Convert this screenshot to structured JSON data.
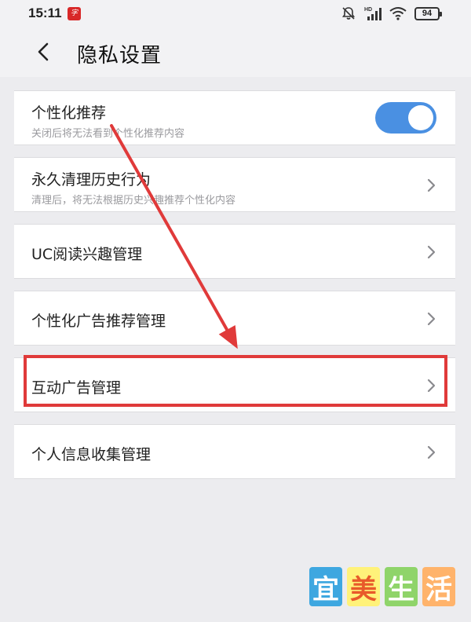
{
  "status_bar": {
    "time": "15:11",
    "app_badge": "字",
    "battery": "94",
    "icons": [
      "bell-muted-icon",
      "signal-icon",
      "wifi-icon",
      "battery-icon"
    ]
  },
  "header": {
    "back_icon": "chevron-left-icon",
    "title": "隐私设置"
  },
  "settings": {
    "personalized": {
      "title": "个性化推荐",
      "subtitle": "关闭后将无法看到个性化推荐内容",
      "toggle_on": true
    },
    "clear_history": {
      "title": "永久清理历史行为",
      "subtitle": "清理后，将无法根据历史兴趣推荐个性化内容"
    },
    "uc_interest": {
      "title": "UC阅读兴趣管理"
    },
    "ad_recommend": {
      "title": "个性化广告推荐管理"
    },
    "interactive_ad": {
      "title": "互动广告管理"
    },
    "personal_info": {
      "title": "个人信息收集管理"
    }
  },
  "watermark": {
    "chars": [
      "宜",
      "美",
      "生",
      "活"
    ]
  },
  "colors": {
    "accent": "#4a90e2",
    "annotation": "#e03a3a",
    "background": "#ececef",
    "card": "#ffffff"
  }
}
